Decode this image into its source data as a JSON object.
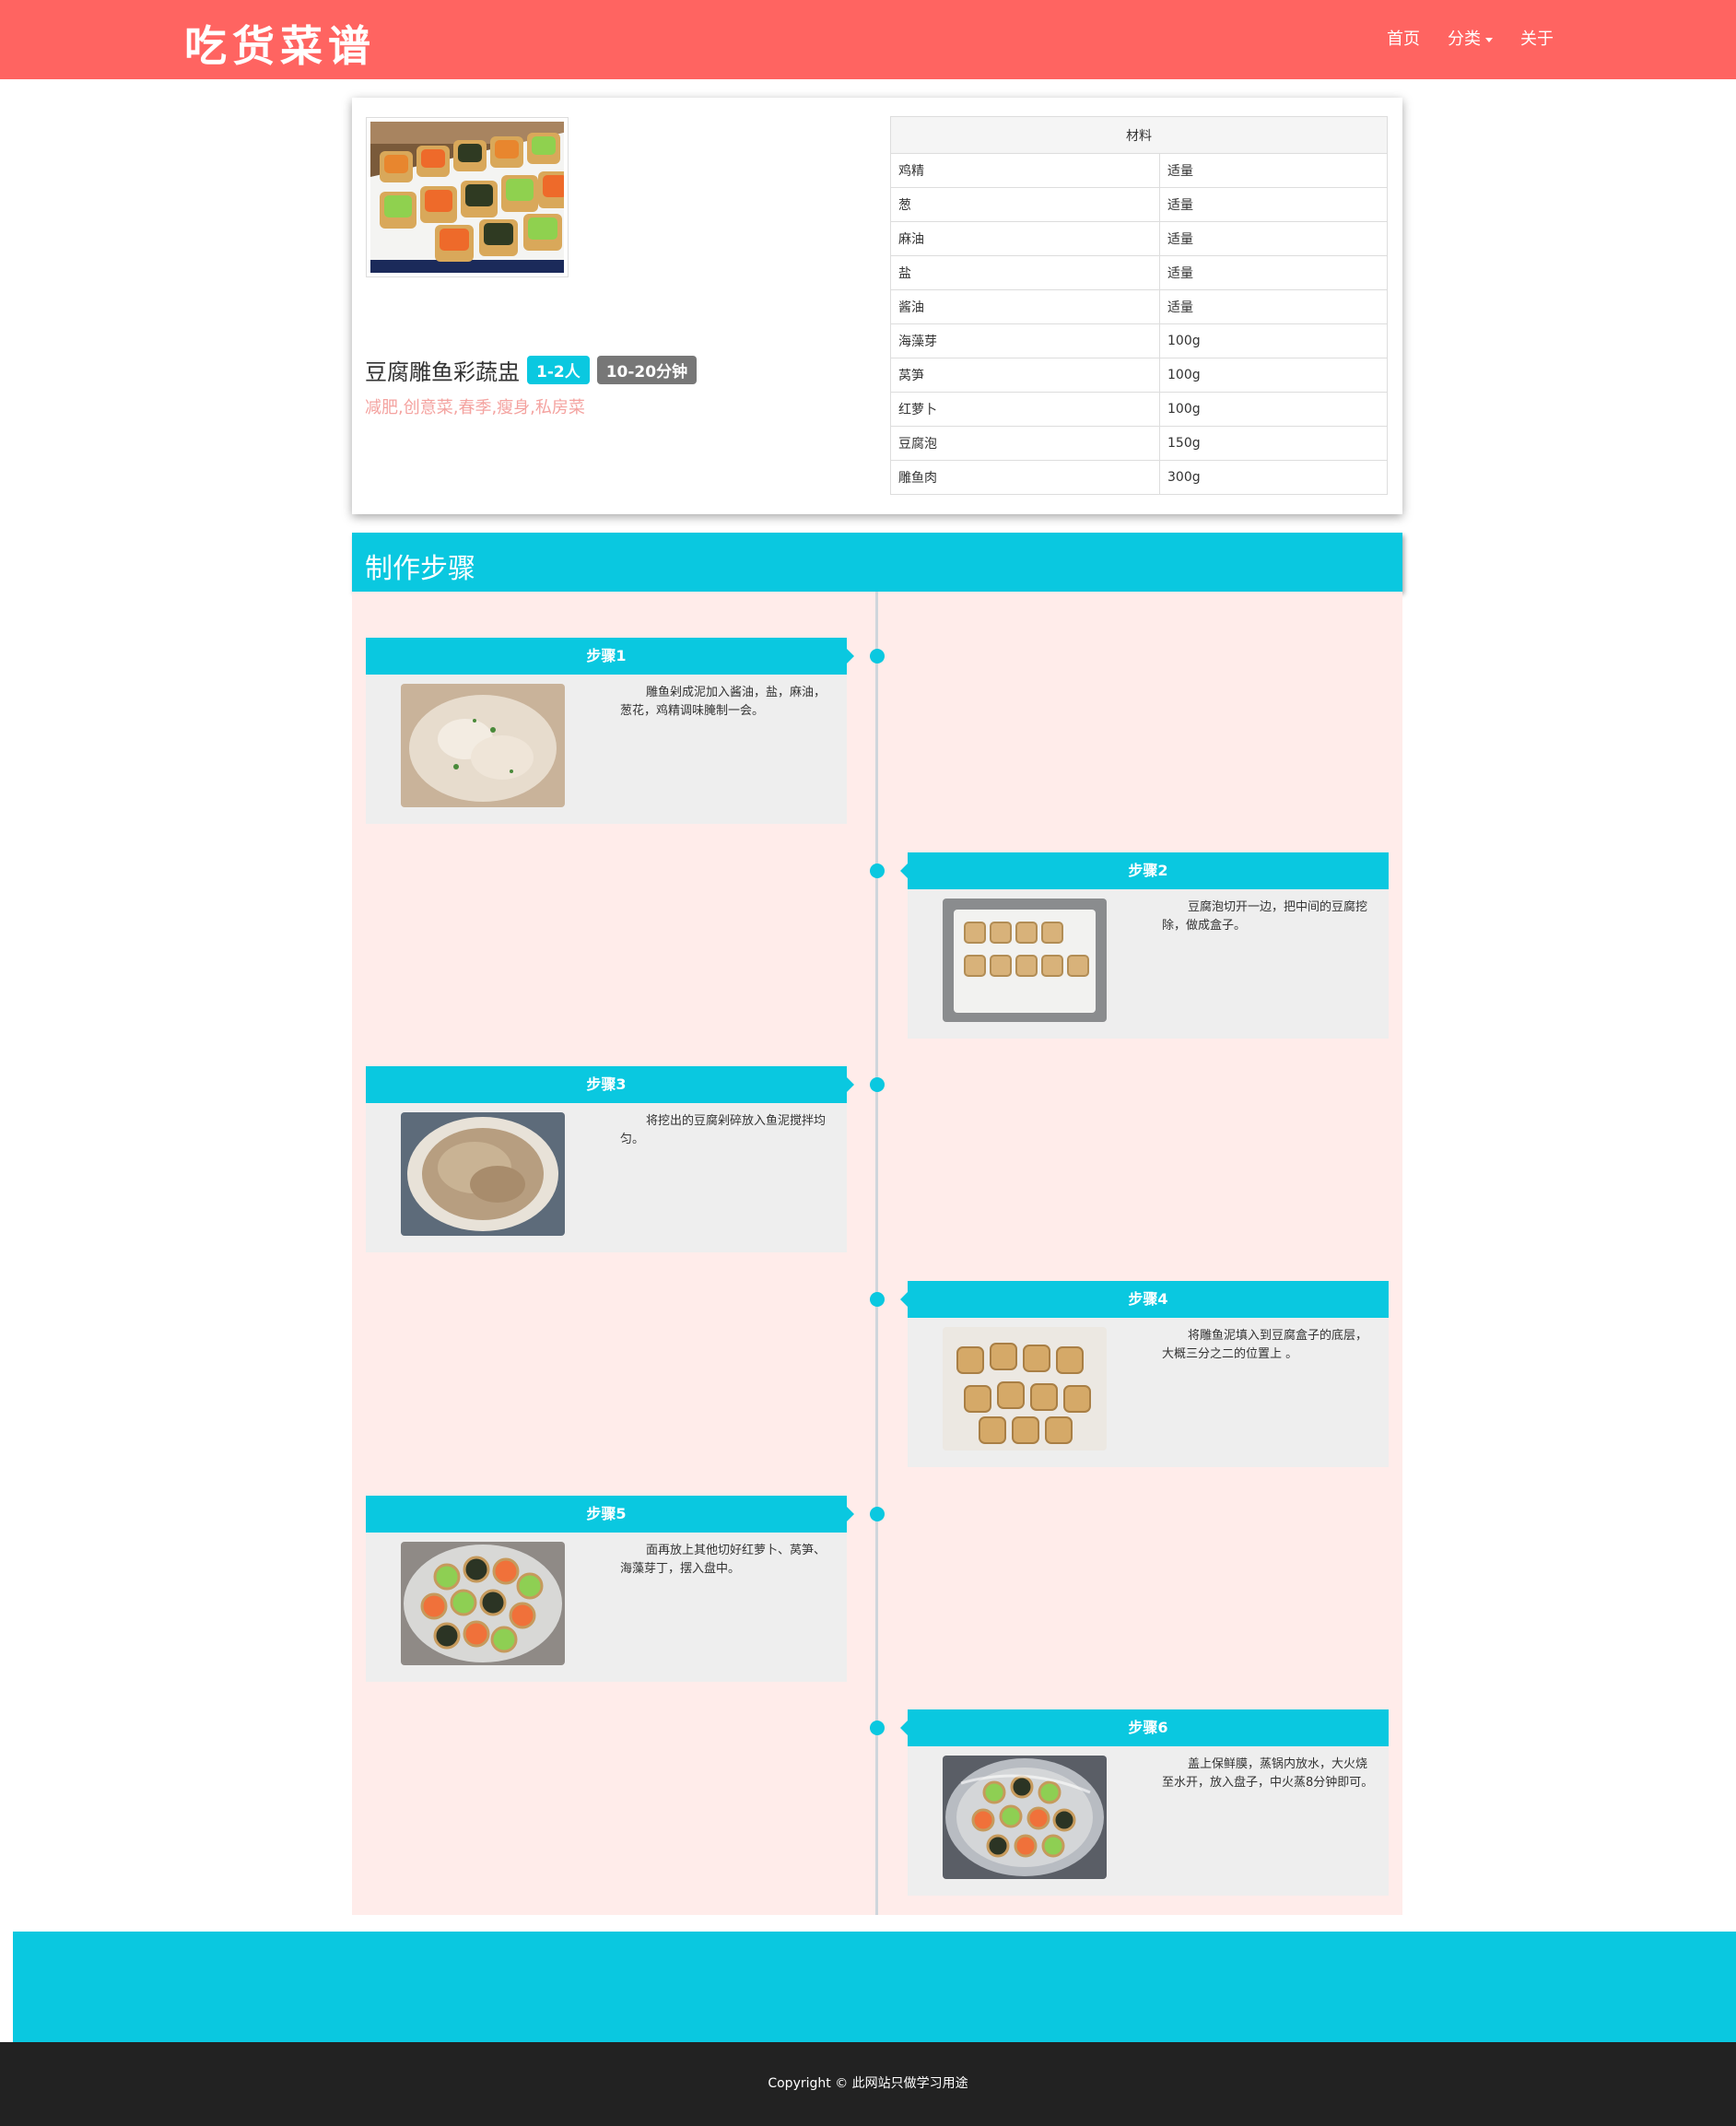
{
  "header": {
    "logo": "吃货菜谱",
    "nav": [
      {
        "label": "首页"
      },
      {
        "label": "分类"
      },
      {
        "label": "关于"
      }
    ]
  },
  "recipe": {
    "title": "豆腐雕鱼彩蔬盅",
    "servings": "1-2人",
    "time": "10-20分钟",
    "tags": "减肥,创意菜,春季,瘦身,私房菜",
    "ingredients_header": "材料",
    "ingredients": [
      {
        "name": "鸡精",
        "amount": "适量"
      },
      {
        "name": "葱",
        "amount": "适量"
      },
      {
        "name": "麻油",
        "amount": "适量"
      },
      {
        "name": "盐",
        "amount": "适量"
      },
      {
        "name": "酱油",
        "amount": "适量"
      },
      {
        "name": "海藻芽",
        "amount": "100g"
      },
      {
        "name": "莴笋",
        "amount": "100g"
      },
      {
        "name": "红萝卜",
        "amount": "100g"
      },
      {
        "name": "豆腐泡",
        "amount": "150g"
      },
      {
        "name": "雕鱼肉",
        "amount": "300g"
      }
    ]
  },
  "steps_section": {
    "title": "制作步骤",
    "steps": [
      {
        "label": "步骤1",
        "text": "雕鱼剁成泥加入酱油，盐，麻油，葱花，鸡精调味腌制一会。"
      },
      {
        "label": "步骤2",
        "text": "豆腐泡切开一边，把中间的豆腐挖除，做成盒子。"
      },
      {
        "label": "步骤3",
        "text": "将挖出的豆腐剁碎放入鱼泥搅拌均匀。"
      },
      {
        "label": "步骤4",
        "text": "将雕鱼泥填入到豆腐盒子的底层，大概三分之二的位置上 。"
      },
      {
        "label": "步骤5",
        "text": "面再放上其他切好红萝卜、莴笋、海藻芽丁，摆入盘中。"
      },
      {
        "label": "步骤6",
        "text": "盖上保鲜膜，蒸锅内放水，大火烧至水开，放入盘子，中火蒸8分钟即可。"
      }
    ]
  },
  "footer": {
    "copyright": "Copyright © 此网站只做学习用途"
  },
  "colors": {
    "header": "#ff6461",
    "accent": "#0ac8e0",
    "steps_bg": "#ffecea",
    "footer_bar": "#222222"
  }
}
